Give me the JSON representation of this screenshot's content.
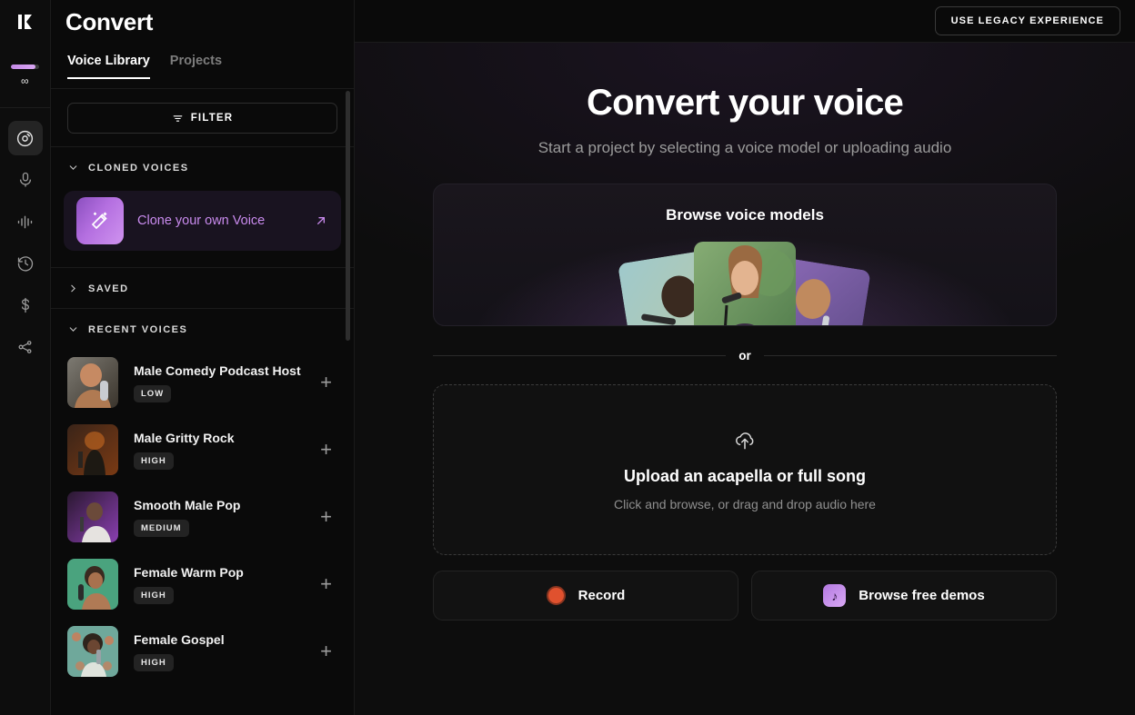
{
  "app": {
    "title": "Convert",
    "logo_icon": "klay-logo-icon"
  },
  "topbar": {
    "legacy_button": "USE LEGACY EXPERIENCE"
  },
  "rail": {
    "quota": {
      "label": "∞",
      "percent": 88,
      "accent": "#c58ae8"
    },
    "items": [
      {
        "name": "convert",
        "icon": "vinyl-record-icon",
        "active": true
      },
      {
        "name": "record",
        "icon": "microphone-icon",
        "active": false
      },
      {
        "name": "studio",
        "icon": "waveform-icon",
        "active": false
      },
      {
        "name": "history",
        "icon": "clock-history-icon",
        "active": false
      },
      {
        "name": "billing",
        "icon": "dollar-icon",
        "active": false
      },
      {
        "name": "share",
        "icon": "share-nodes-icon",
        "active": false
      }
    ]
  },
  "sidebar": {
    "tabs": [
      {
        "label": "Voice Library",
        "active": true
      },
      {
        "label": "Projects",
        "active": false
      }
    ],
    "filter_label": "FILTER",
    "filter_icon": "filter-icon",
    "sections": {
      "cloned": {
        "label": "CLONED VOICES",
        "expanded": true
      },
      "saved": {
        "label": "SAVED",
        "expanded": false
      },
      "recent": {
        "label": "RECENT VOICES",
        "expanded": true
      }
    },
    "clone_row": {
      "label": "Clone your own Voice",
      "icon": "magic-wand-icon",
      "arrow_icon": "arrow-up-right-icon",
      "accent": "#c98bee"
    },
    "voices": [
      {
        "name": "Male Comedy Podcast Host",
        "badge": "LOW",
        "add_icon": "plus-icon"
      },
      {
        "name": "Male Gritty Rock",
        "badge": "HIGH",
        "add_icon": "plus-icon"
      },
      {
        "name": "Smooth Male Pop",
        "badge": "MEDIUM",
        "add_icon": "plus-icon"
      },
      {
        "name": "Female Warm Pop",
        "badge": "HIGH",
        "add_icon": "plus-icon"
      },
      {
        "name": "Female Gospel",
        "badge": "HIGH",
        "add_icon": "plus-icon"
      }
    ]
  },
  "main": {
    "hero_title": "Convert your voice",
    "hero_subtitle": "Start a project by selecting a voice model or uploading audio",
    "browse_card": {
      "title": "Browse voice models"
    },
    "divider_label": "or",
    "upload": {
      "icon": "cloud-upload-icon",
      "title": "Upload an acapella or full song",
      "subtitle": "Click and browse, or drag and drop audio here"
    },
    "actions": [
      {
        "label": "Record",
        "icon": "record-circle-icon"
      },
      {
        "label": "Browse free demos",
        "icon": "music-note-icon"
      }
    ]
  }
}
